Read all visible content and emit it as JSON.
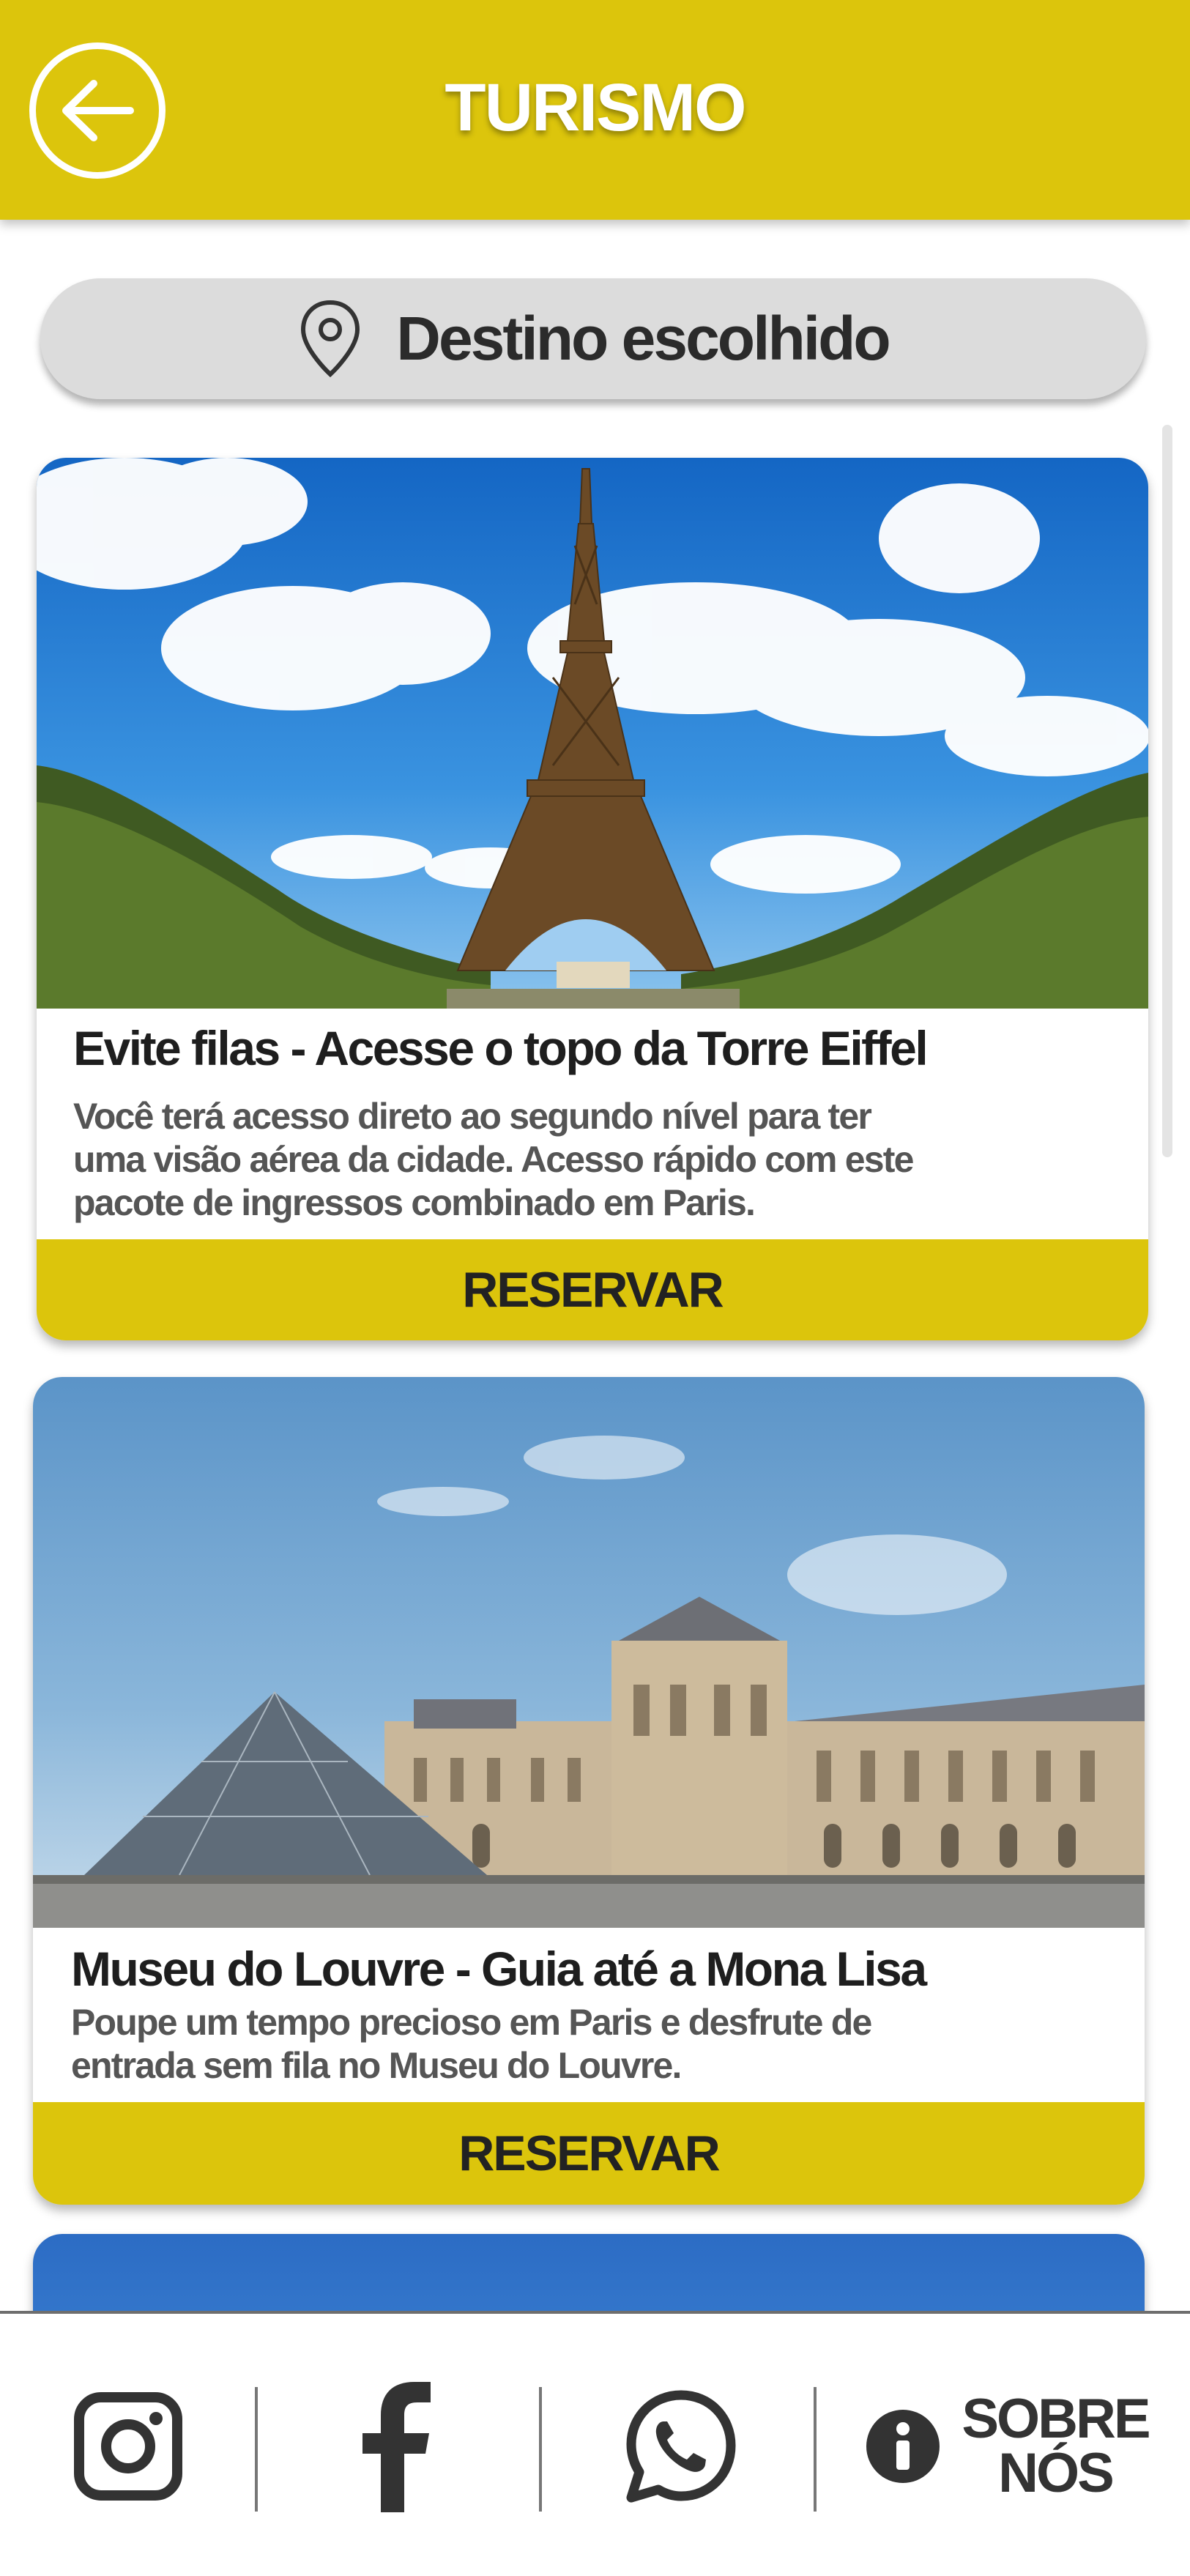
{
  "header": {
    "title": "TURISMO"
  },
  "destination": {
    "label": "Destino escolhido"
  },
  "cards": [
    {
      "title": "Evite filas - Acesse o topo da Torre Eiffel",
      "description_lines": [
        "Você terá acesso direto  ao  segundo nível para  ter",
        "uma  visão aérea da cidade. Acesso rápido com este",
        "pacote de ingressos combinado em Paris."
      ],
      "button": "RESERVAR"
    },
    {
      "title": "Museu do Louvre - Guia até a Mona Lisa",
      "description_lines": [
        "Poupe um tempo precioso em Paris e desfrute de",
        "entrada sem fila no Museu do Louvre."
      ],
      "button": "RESERVAR"
    }
  ],
  "bottom_nav": {
    "items": [
      {
        "icon": "instagram-icon"
      },
      {
        "icon": "facebook-icon"
      },
      {
        "icon": "whatsapp-icon"
      },
      {
        "icon": "info-icon",
        "label_line1": "SOBRE",
        "label_line2": "NÓS"
      }
    ]
  },
  "colors": {
    "accent": "#dcc50c",
    "pill": "#dcdcdc",
    "sky": "#1f7fd6"
  }
}
